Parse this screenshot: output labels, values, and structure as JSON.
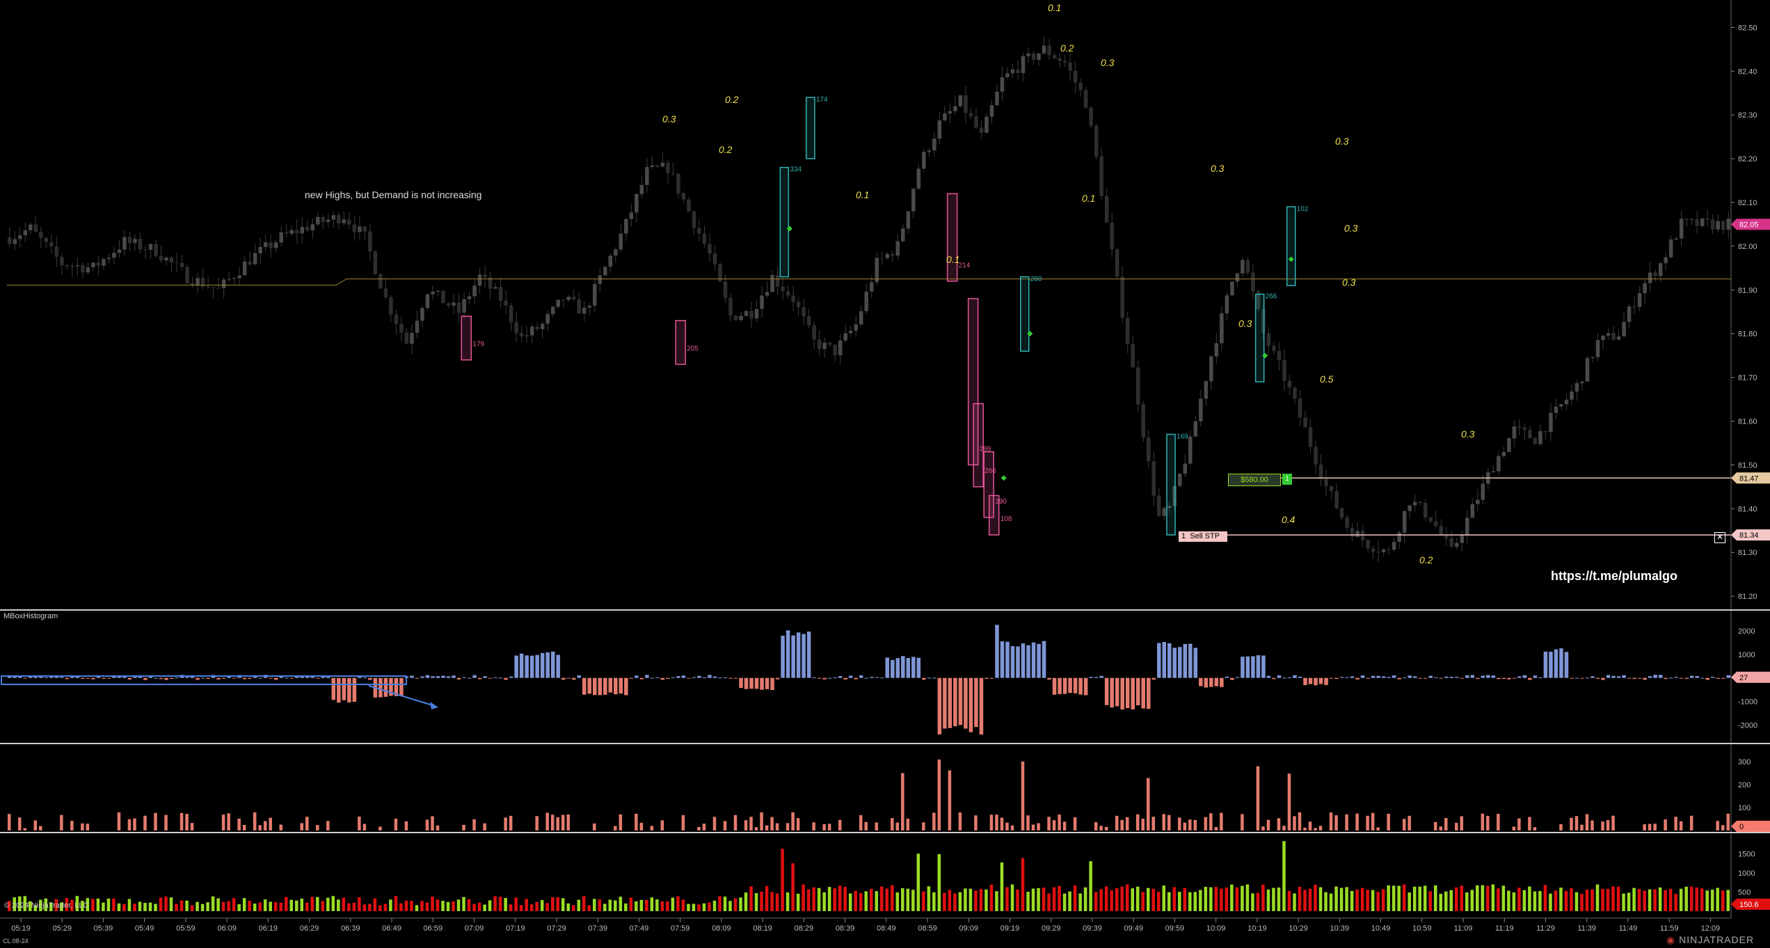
{
  "instrument": "CL 08-24",
  "copyright": "© 2024 NinjaTrader, LLC",
  "brand": "NINJATRADER",
  "watermark": "https://t.me/plumalgo",
  "annotation": "new Highs, but Demand is not increasing",
  "indicator_label": "MBoxHistogram",
  "order_labels": {
    "pnl": "$580.00",
    "qty": "1",
    "stop_qty": "1",
    "stop": "Sell STP"
  },
  "colors": {
    "bg": "#000000",
    "candle": "#555555",
    "pink": "#e8569b",
    "teal": "#2fb3b3",
    "green": "#33cc33",
    "yellow": "#f2e14b",
    "blue": "#7f96d6",
    "salmon": "#e37b6e",
    "red": "#e01010",
    "lime": "#9bdc25"
  },
  "chart_data": [
    {
      "type": "candlestick",
      "panel": "price",
      "y_ticks": [
        "82.50",
        "82.40",
        "82.30",
        "82.20",
        "82.10",
        "82.00",
        "81.90",
        "81.80",
        "81.70",
        "81.60",
        "81.50",
        "81.40",
        "81.30",
        "81.20"
      ],
      "ylim": [
        81.17,
        82.55
      ],
      "x_ticks": [
        "05:19",
        "05:29",
        "05:39",
        "05:49",
        "05:59",
        "06:09",
        "06:19",
        "06:29",
        "06:39",
        "06:49",
        "06:59",
        "07:09",
        "07:19",
        "07:29",
        "07:39",
        "07:49",
        "07:59",
        "08:09",
        "08:19",
        "08:29",
        "08:39",
        "08:49",
        "08:59",
        "09:09",
        "09:19",
        "09:29",
        "09:39",
        "09:49",
        "09:59",
        "10:09",
        "10:19",
        "10:29",
        "10:39",
        "10:49",
        "10:59",
        "11:09",
        "11:19",
        "11:29",
        "11:39",
        "11:49",
        "11:59",
        "12:09"
      ],
      "price_path": [
        [
          0,
          82.02
        ],
        [
          4,
          82.04
        ],
        [
          10,
          81.96
        ],
        [
          16,
          81.95
        ],
        [
          22,
          82.01
        ],
        [
          28,
          81.99
        ],
        [
          34,
          81.93
        ],
        [
          40,
          81.9
        ],
        [
          46,
          81.97
        ],
        [
          52,
          82.02
        ],
        [
          58,
          82.05
        ],
        [
          64,
          82.07
        ],
        [
          68,
          82.02
        ],
        [
          72,
          81.88
        ],
        [
          76,
          81.78
        ],
        [
          80,
          81.9
        ],
        [
          86,
          81.85
        ],
        [
          90,
          81.93
        ],
        [
          94,
          81.88
        ],
        [
          98,
          81.79
        ],
        [
          102,
          81.82
        ],
        [
          106,
          81.88
        ],
        [
          110,
          81.85
        ],
        [
          114,
          81.95
        ],
        [
          118,
          82.05
        ],
        [
          122,
          82.17
        ],
        [
          126,
          82.18
        ],
        [
          130,
          82.08
        ],
        [
          134,
          81.98
        ],
        [
          138,
          81.84
        ],
        [
          142,
          81.85
        ],
        [
          146,
          81.93
        ],
        [
          150,
          81.88
        ],
        [
          154,
          81.78
        ],
        [
          158,
          81.76
        ],
        [
          162,
          81.82
        ],
        [
          166,
          81.96
        ],
        [
          170,
          82.0
        ],
        [
          174,
          82.18
        ],
        [
          178,
          82.28
        ],
        [
          182,
          82.33
        ],
        [
          186,
          82.25
        ],
        [
          190,
          82.38
        ],
        [
          194,
          82.42
        ],
        [
          198,
          82.45
        ],
        [
          202,
          82.42
        ],
        [
          206,
          82.33
        ],
        [
          208,
          82.2
        ],
        [
          210,
          82.05
        ],
        [
          213,
          81.85
        ],
        [
          216,
          81.65
        ],
        [
          218,
          81.5
        ],
        [
          220,
          81.38
        ],
        [
          222,
          81.4
        ],
        [
          226,
          81.55
        ],
        [
          230,
          81.75
        ],
        [
          234,
          81.92
        ],
        [
          236,
          81.98
        ],
        [
          240,
          81.8
        ],
        [
          244,
          81.7
        ],
        [
          248,
          81.58
        ],
        [
          252,
          81.45
        ],
        [
          256,
          81.36
        ],
        [
          260,
          81.32
        ],
        [
          264,
          81.3
        ],
        [
          268,
          81.42
        ],
        [
          272,
          81.38
        ],
        [
          276,
          81.3
        ],
        [
          280,
          81.4
        ],
        [
          284,
          81.5
        ],
        [
          288,
          81.58
        ],
        [
          292,
          81.56
        ],
        [
          296,
          81.62
        ],
        [
          300,
          81.68
        ],
        [
          304,
          81.78
        ],
        [
          308,
          81.8
        ],
        [
          312,
          81.9
        ],
        [
          316,
          81.96
        ],
        [
          320,
          82.05
        ]
      ],
      "ranges": [
        [
          81.85,
          81.95
        ],
        [
          82.0,
          82.12
        ],
        [
          82.15,
          82.25
        ],
        [
          82.3,
          82.4
        ],
        [
          82.42,
          82.5
        ],
        [
          81.7,
          81.8
        ]
      ],
      "levels": {
        "high": 82.5,
        "low": 81.26
      },
      "order_lines": {
        "avg_fill": 81.47,
        "sell_stop": 81.34,
        "current": 82.05
      },
      "boxes": [
        {
          "color": "pink",
          "label": "179"
        },
        {
          "color": "pink",
          "label": "205"
        },
        {
          "color": "teal",
          "label": "334"
        },
        {
          "color": "teal",
          "label": "174"
        },
        {
          "color": "pink",
          "label": "214"
        },
        {
          "color": "pink",
          "label": "299"
        },
        {
          "color": "pink",
          "label": "266"
        },
        {
          "color": "pink",
          "label": "190"
        },
        {
          "color": "pink",
          "label": "108"
        },
        {
          "color": "teal",
          "label": "280"
        },
        {
          "color": "teal",
          "label": "169"
        },
        {
          "color": "teal",
          "label": "266"
        },
        {
          "color": "teal",
          "label": "102"
        }
      ],
      "delta_labels": [
        "0.3",
        "0.1",
        "0.2",
        "0.3",
        "0.2",
        "0.2",
        "0.1",
        "0.1",
        "0.1",
        "0.3",
        "0.3",
        "0.3",
        "0.3",
        "0.5",
        "0.4",
        "0.3",
        "0.3",
        "0.2"
      ]
    },
    {
      "type": "bar",
      "panel": "MBoxHistogram",
      "y_ticks": [
        "2000",
        "1000",
        "0",
        "-1000",
        "-2000"
      ],
      "ylim": [
        -2700,
        2800
      ],
      "last_value": "27"
    },
    {
      "type": "bar",
      "panel": "volume1",
      "y_ticks": [
        "300",
        "200",
        "100"
      ],
      "ylim": [
        0,
        370
      ],
      "last_value": "0"
    },
    {
      "type": "bar",
      "panel": "volume2",
      "y_ticks": [
        "1500",
        "1000",
        "500"
      ],
      "ylim": [
        0,
        2000
      ],
      "last_value": "150.6"
    }
  ]
}
